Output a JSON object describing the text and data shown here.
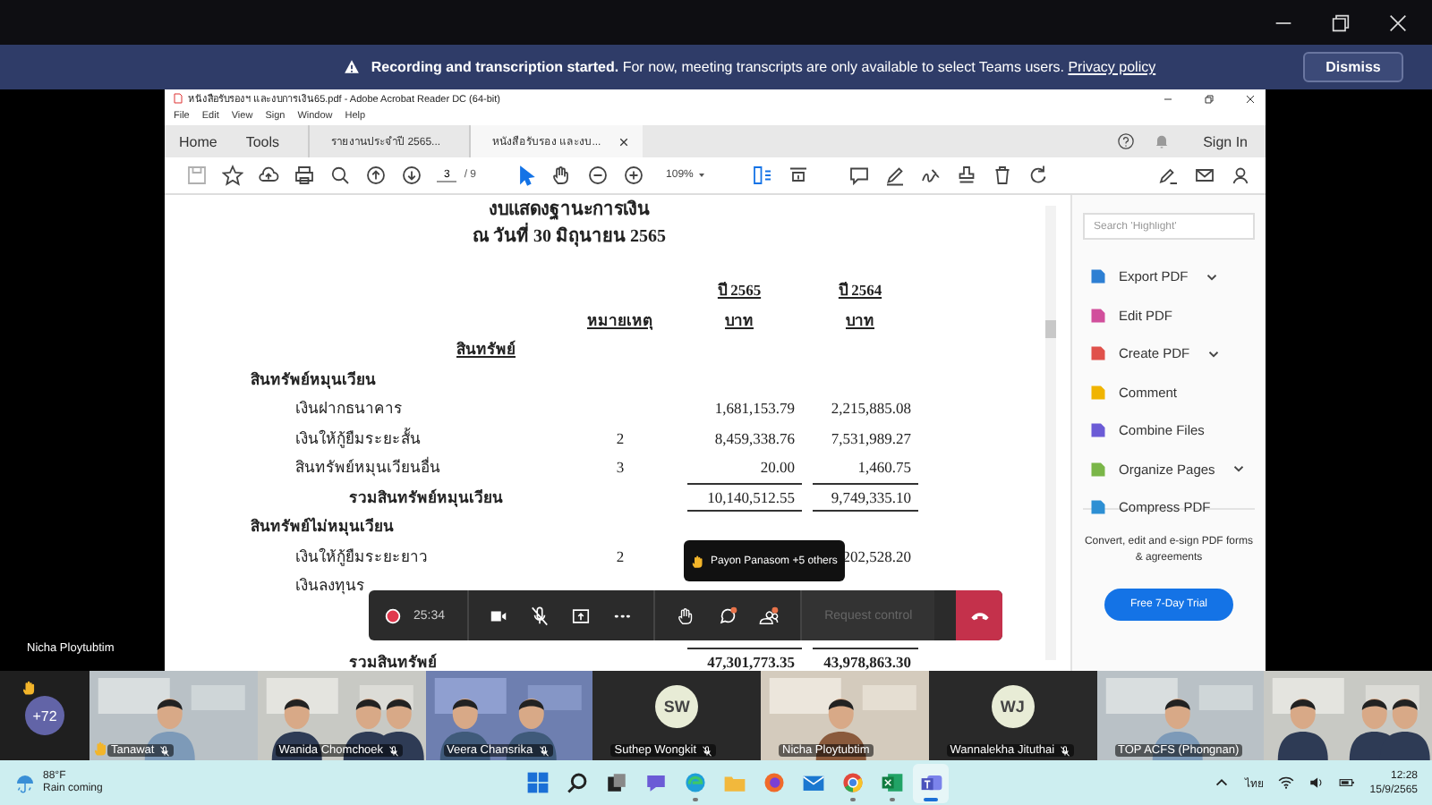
{
  "banner": {
    "title": "Recording and transcription started.",
    "message": "For now, meeting transcripts are only available to select Teams users.",
    "link": "Privacy policy",
    "button": "Dismiss"
  },
  "presenter_label": "Nicha Ploytubtim",
  "acrobat": {
    "title": "หนังสือรับรองฯ และงบการเงิน65.pdf - Adobe Acrobat Reader DC (64-bit)",
    "menu": [
      "File",
      "Edit",
      "View",
      "Sign",
      "Window",
      "Help"
    ],
    "nav": [
      "Home",
      "Tools"
    ],
    "doc_tabs": [
      {
        "label": "รายงานประจำปี 2565...",
        "selected": false
      },
      {
        "label": "หนังสือรับรอง และงบ...",
        "selected": true
      }
    ],
    "sign_in": "Sign In",
    "page": "3",
    "page_total": "/ 9",
    "zoom": "109%",
    "document": {
      "title": "งบแสดงฐานะการเงิน",
      "date": "ณ วันที่  30 มิถุนายน  2565",
      "year_headers": [
        "ปี 2565",
        "ปี 2564"
      ],
      "note_header": "หมายเหตุ",
      "unit_headers": [
        "บาท",
        "บาท"
      ],
      "rows": [
        {
          "kind": "section",
          "label": "สินทรัพย์"
        },
        {
          "kind": "group",
          "label": "สินทรัพย์หมุนเวียน"
        },
        {
          "kind": "item",
          "label": "เงินฝากธนาคาร",
          "current": "1,681,153.79",
          "previous": "2,215,885.08"
        },
        {
          "kind": "item",
          "label": "เงินให้กู้ยืมระยะสั้น",
          "note": "2",
          "current": "8,459,338.76",
          "previous": "7,531,989.27"
        },
        {
          "kind": "item",
          "label": "สินทรัพย์หมุนเวียนอื่น",
          "note": "3",
          "current": "20.00",
          "previous": "1,460.75"
        },
        {
          "kind": "total",
          "label": "รวมสินทรัพย์หมุนเวียน",
          "current": "10,140,512.55",
          "previous": "9,749,335.10"
        },
        {
          "kind": "group",
          "label": "สินทรัพย์ไม่หมุนเวียน"
        },
        {
          "kind": "item",
          "label": "เงินให้กู้ยืมระยะยาว",
          "note": "2",
          "previous": "202,528.20"
        },
        {
          "kind": "item",
          "label": "เงินลงทุนร"
        },
        {
          "kind": "grand",
          "label": "รวมสินทรัพย์",
          "current": "47,301,773.35",
          "previous": "43,978,863.30"
        }
      ]
    },
    "tools_pane": {
      "search_placeholder": "Search 'Highlight'",
      "tools": [
        {
          "label": "Export PDF",
          "expandable": true,
          "color": "#2d7fd3"
        },
        {
          "label": "Edit PDF",
          "expandable": false,
          "color": "#d14f9c"
        },
        {
          "label": "Create PDF",
          "expandable": true,
          "color": "#e0514b"
        },
        {
          "label": "Comment",
          "expandable": false,
          "color": "#f0b400"
        },
        {
          "label": "Combine Files",
          "expandable": false,
          "color": "#6b5bd6"
        },
        {
          "label": "Organize Pages",
          "expandable": true,
          "color": "#7ab648"
        },
        {
          "label": "Compress PDF",
          "expandable": false,
          "color": "#2d8fd3"
        }
      ],
      "promo": "Convert, edit and e-sign PDF forms & agreements",
      "trial_button": "Free 7-Day Trial"
    }
  },
  "meeting_bar": {
    "timer": "25:34",
    "request_control": {
      "label": "Request control",
      "disabled": true
    },
    "tooltip": "Payon Panasom +5 others"
  },
  "participants": [
    {
      "kind": "overflow",
      "label": "+72",
      "hand_raised": true
    },
    {
      "kind": "video",
      "name": "Tanawat",
      "hand_raised": true,
      "muted": true
    },
    {
      "kind": "video",
      "name": "Wanida Chomchoek",
      "hand_raised": false,
      "muted": true
    },
    {
      "kind": "video",
      "name": "Veera Chansrika",
      "hand_raised": false,
      "muted": true
    },
    {
      "kind": "avatar",
      "name": "Suthep Wongkit",
      "initials": "SW",
      "hand_raised": false,
      "muted": true
    },
    {
      "kind": "video",
      "name": "Nicha Ploytubtim",
      "hand_raised": false,
      "muted": false
    },
    {
      "kind": "avatar",
      "name": "Wannalekha Jituthai",
      "initials": "WJ",
      "hand_raised": false,
      "muted": true
    },
    {
      "kind": "video",
      "name": "TOP ACFS (Phongnan)",
      "hand_raised": false,
      "muted": false
    },
    {
      "kind": "video",
      "hand_raised": false,
      "muted": false
    }
  ],
  "taskbar": {
    "weather": {
      "temp": "88°F",
      "forecast": "Rain coming"
    },
    "apps": [
      {
        "kind": "start",
        "selected": false,
        "running": false
      },
      {
        "kind": "search",
        "selected": false,
        "running": false
      },
      {
        "kind": "taskview",
        "selected": false,
        "running": false
      },
      {
        "kind": "chat",
        "selected": false,
        "running": false
      },
      {
        "kind": "edge",
        "selected": false,
        "running": true
      },
      {
        "kind": "folder",
        "selected": false,
        "running": false
      },
      {
        "kind": "firefox",
        "selected": false,
        "running": false
      },
      {
        "kind": "mail",
        "selected": false,
        "running": false
      },
      {
        "kind": "chrome",
        "selected": false,
        "running": true
      },
      {
        "kind": "excel",
        "selected": false,
        "running": true
      },
      {
        "kind": "teams",
        "selected": true,
        "running": true
      }
    ],
    "language": "ไทย",
    "time": "12:28",
    "date": "15/9/2565"
  }
}
